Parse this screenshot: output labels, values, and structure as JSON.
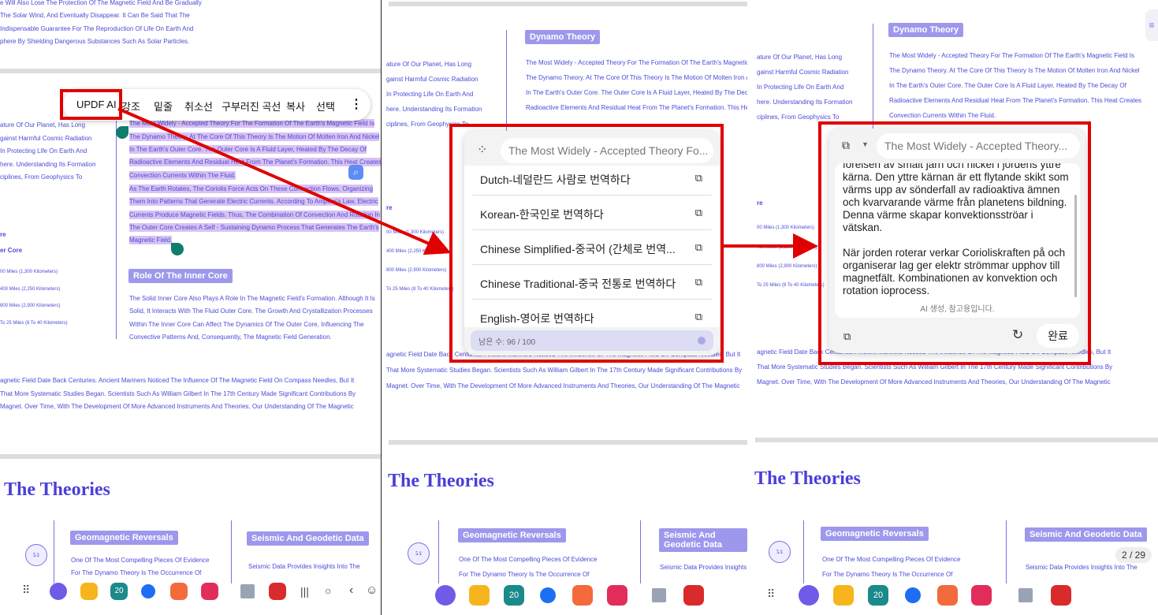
{
  "doc": {
    "top_lines": [
      "e Will Also Lose The Protection Of The Magnetic Field And Be Gradually",
      "The Solar Wind, And Eventually Disappear. It Can Be Said That The",
      "Indispensable Guarantee For The Reproduction Of Life On Earth And",
      "phere By Shielding Dangerous Substances Such As Solar Particles."
    ],
    "left_col_lines": [
      "ature Of Our Planet, Has Long",
      "gainst Harmful Cosmic Radiation",
      " In Protecting Life On Earth And",
      "here. Understanding Its Formation",
      "ciplines, From Geophysics To"
    ],
    "dynamo_tag": "Dynamo Theory",
    "dynamo_lines": [
      "The Most Widely - Accepted Theory For The Formation Of The Earth's Magnetic Field Is",
      "The Dynamo Theory. At The Core Of This Theory Is The Motion Of Molten Iron And Nickel",
      "In The Earth's Outer Core. The Outer Core Is A Fluid Layer, Heated By The Decay Of",
      "Radioactive Elements And Residual Heat From The Planet's Formation. This Heat Creates",
      "Convection Currents Within The Fluid.",
      "As The Earth Rotates, The Coriolis Force Acts On These Convection Flows, Organizing",
      "Them Into Patterns That Generate Electric Currents. According To Ampere's Law, Electric",
      "Currents Produce Magnetic Fields. Thus, The Combination Of Convection And Rotation In",
      "The Outer Core Creates A Self - Sustaining Dynamo Process That Generates The Earth's",
      "Magnetic Field."
    ],
    "core_labels": [
      "re",
      "er Core"
    ],
    "core_values": [
      "00 Miles (1,300 Kilometers)",
      "400 Miles (2,250 Kilometers)",
      "800 Miles (2,900 Kilometers)",
      "To 25 Miles (8 To 40 Kilometers)"
    ],
    "inner_core_tag": "Role Of The Inner Core",
    "inner_core_lines": [
      "The Solid Inner Core Also Plays A Role In The Magnetic Field's Formation. Although It Is",
      "Solid, It Interacts With The Fluid Outer Core. The Growth And Crystallization Processes",
      "Within The Inner Core Can Affect The Dynamics Of The Outer Core, Influencing The",
      "Convective Patterns And, Consequently, The Magnetic Field Generation."
    ],
    "history_lines": [
      "agnetic Field Date Back Centuries. Ancient Mariners Noticed The Influence Of The Magnetic Field On Compass Needles, But It",
      "That More Systematic Studies Began. Scientists Such As William Gilbert In The 17th Century Made Significant Contributions By",
      " Magnet. Over Time, With The Development Of More Advanced Instruments And Theories, Our Understanding Of The Magnetic"
    ],
    "theories_title": "The Theories",
    "geo_tag": "Geomagnetic Reversals",
    "geo_lines": [
      "One Of The Most Compelling Pieces Of Evidence",
      "For The Dynamo Theory Is The Occurrence Of"
    ],
    "seismic_tag": "Seismic And Geodetic Data",
    "seismic_lines": [
      "Seismic Data Provides Insights Into The"
    ]
  },
  "context_menu": {
    "items": [
      "UPDF AI",
      "강조",
      "밑줄",
      "취소선",
      "구부러진 곡선",
      "복사",
      "선택"
    ],
    "more_icon": "more-vertical-icon"
  },
  "translate_popup": {
    "prompt_preview": "The Most Widely - Accepted Theory Fo...",
    "languages": [
      "Dutch-네덜란드 사람로 번역하다",
      "Korean-한국인로 번역하다",
      "Chinese Simplified-중국어 (간체로 번역...",
      "Chinese Traditional-중국 전통로 번역하다",
      "English-영어로 번역하다"
    ],
    "remaining": "남은 수: 96 / 100"
  },
  "result_popup": {
    "prompt_preview": "The Most Widely - Accepted Theory...",
    "translation_p1": "foreisen av smält järn och nickel i jordens yttre kärna. Den yttre kärnan är ett flytande skikt som värms upp av sönderfall av radioaktiva ämnen och kvarvarande värme från planetens bildning. Denna värme skapar konvektionsströar i vätskan.",
    "translation_p2": "När jorden roterar verkar Corioliskraften på och organiserar lag ger elektr strömmar upphov till magnetfält. Kombinationen av konvektion och rotation ioprocess.",
    "footer_note": "AI 생성, 참고용입니다.",
    "done_label": "완료"
  },
  "page_indicator": "2 / 29",
  "colors": {
    "accent_red": "#e00000",
    "doc_text": "#4a4ad8",
    "tag_bg": "#9d98ec",
    "highlight": "#d9c2f2"
  }
}
